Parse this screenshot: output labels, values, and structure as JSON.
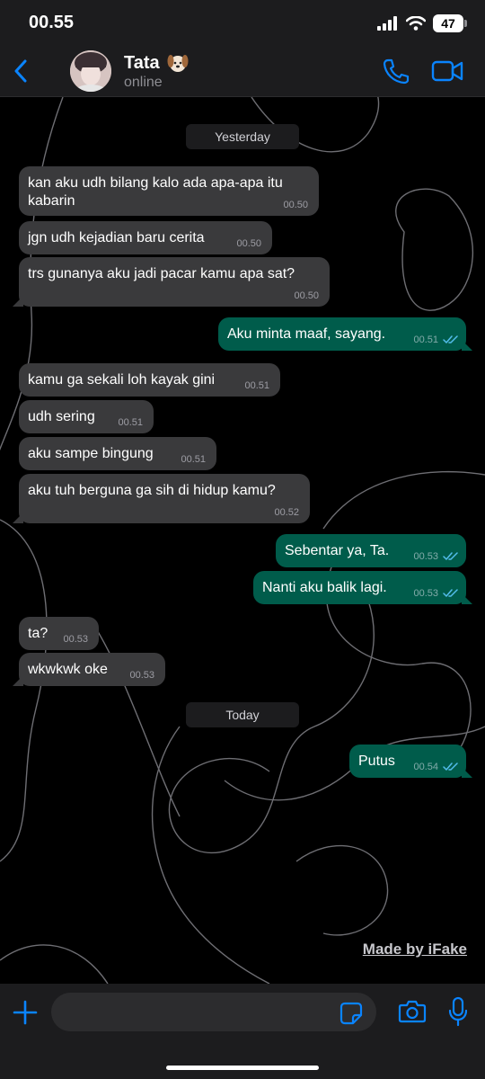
{
  "status_bar": {
    "time": "00.55",
    "battery": "47"
  },
  "header": {
    "contact_name": "Tata",
    "contact_status": "online"
  },
  "dates": {
    "yesterday": "Yesterday",
    "today": "Today"
  },
  "messages": [
    {
      "dir": "in",
      "text": "kan aku udh bilang kalo ada apa-apa itu kabarin",
      "time": "00.50"
    },
    {
      "dir": "in",
      "text": "jgn udh kejadian baru cerita",
      "time": "00.50"
    },
    {
      "dir": "in",
      "text": "trs gunanya aku jadi pacar kamu apa sat?",
      "time": "00.50"
    },
    {
      "dir": "out",
      "text": "Aku minta maaf, sayang.",
      "time": "00.51"
    },
    {
      "dir": "in",
      "text": "kamu ga sekali loh kayak gini",
      "time": "00.51"
    },
    {
      "dir": "in",
      "text": "udh sering",
      "time": "00.51"
    },
    {
      "dir": "in",
      "text": "aku sampe bingung",
      "time": "00.51"
    },
    {
      "dir": "in",
      "text": "aku tuh berguna ga sih di hidup kamu?",
      "time": "00.52"
    },
    {
      "dir": "out",
      "text": "Sebentar ya, Ta.",
      "time": "00.53"
    },
    {
      "dir": "out",
      "text": "Nanti aku balik lagi.",
      "time": "00.53"
    },
    {
      "dir": "in",
      "text": "ta?",
      "time": "00.53"
    },
    {
      "dir": "in",
      "text": "wkwkwk oke",
      "time": "00.53"
    },
    {
      "dir": "out",
      "text": "Putus",
      "time": "00.54"
    }
  ],
  "watermark": "Made by iFake",
  "input": {
    "value": "",
    "placeholder": ""
  },
  "colors": {
    "incoming_bubble": "#3a3a3c",
    "outgoing_bubble": "#005c4b",
    "accent": "#0a84ff",
    "read_ticks": "#53bdeb"
  },
  "icons": {
    "back": "chevron-left-icon",
    "call": "phone-icon",
    "video": "video-camera-icon",
    "plus": "plus-icon",
    "sticker": "sticker-icon",
    "camera": "camera-icon",
    "mic": "microphone-icon"
  }
}
